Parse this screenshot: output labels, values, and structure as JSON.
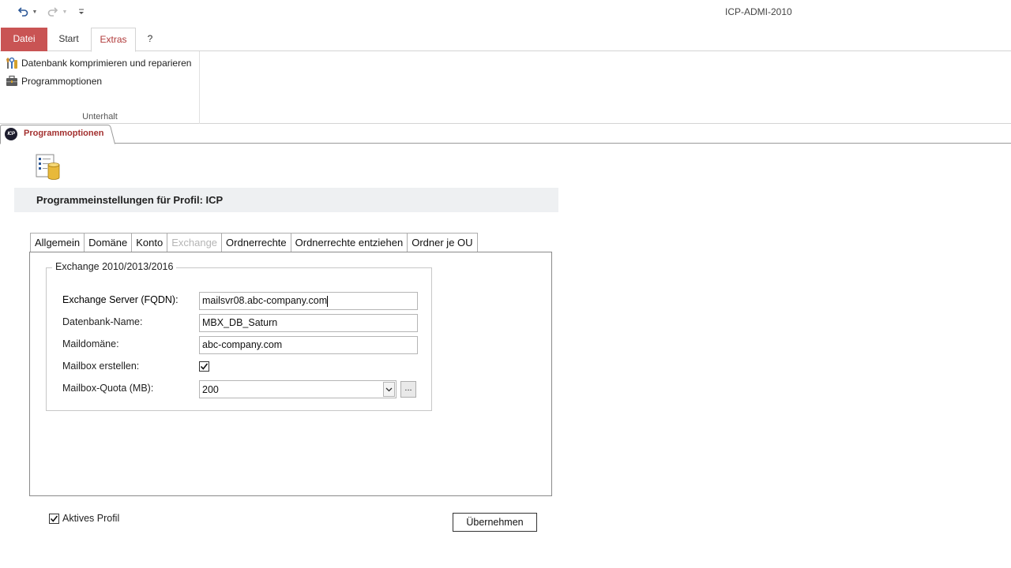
{
  "window": {
    "title": "ICP-ADMI-2010"
  },
  "qat": {
    "undo_icon": "undo-icon",
    "redo_icon": "redo-icon",
    "customize_icon": "customize-qat-icon"
  },
  "ribbon": {
    "tabs": [
      {
        "label": "Datei"
      },
      {
        "label": "Start"
      },
      {
        "label": "Extras"
      },
      {
        "label": "?"
      }
    ],
    "active_tab": "Extras",
    "group": {
      "label": "Unterhalt",
      "commands": [
        {
          "label": "Datenbank komprimieren und reparieren",
          "icon": "db-repair-icon"
        },
        {
          "label": "Programmoptionen",
          "icon": "program-options-icon"
        }
      ]
    }
  },
  "document_tab": {
    "label": "Programmoptionen",
    "logo_text": "ICP"
  },
  "form": {
    "title": "Programmeinstellungen für Profil: ICP",
    "tabs": [
      {
        "label": "Allgemein"
      },
      {
        "label": "Domäne"
      },
      {
        "label": "Konto"
      },
      {
        "label": "Exchange"
      },
      {
        "label": "Ordnerrechte"
      },
      {
        "label": "Ordnerrechte entziehen"
      },
      {
        "label": "Ordner je OU"
      }
    ],
    "active_tab": "Exchange",
    "group_title": "Exchange 2010/2013/2016",
    "fields": {
      "server_label": "Exchange Server (FQDN):",
      "server_value": "mailsvr08.abc-company.com",
      "database_label": "Datenbank-Name:",
      "database_value": "MBX_DB_Saturn",
      "maildomain_label": "Maildomäne:",
      "maildomain_value": "abc-company.com",
      "create_mailbox_label": "Mailbox erstellen:",
      "create_mailbox_checked": true,
      "quota_label": "Mailbox-Quota (MB):",
      "quota_value": "200",
      "quota_more_label": "..."
    },
    "active_profile_label": "Aktives Profil",
    "active_profile_checked": true,
    "apply_label": "Übernehmen"
  },
  "colors": {
    "file_tab_bg": "#c95454",
    "accent_text": "#b03a3a",
    "doc_tab_text": "#a3302f",
    "header_band": "#eef0f2"
  }
}
